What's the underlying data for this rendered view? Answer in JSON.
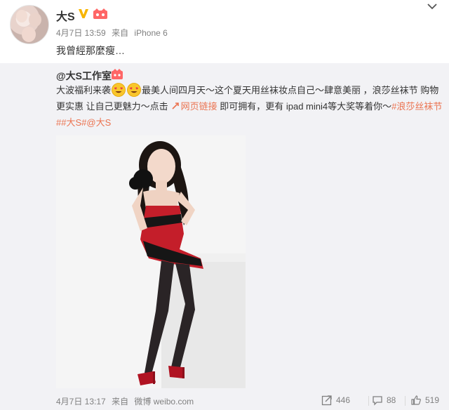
{
  "post": {
    "author": "大S",
    "date": "4月7日 13:59",
    "source_prefix": "来自",
    "source": "iPhone 6",
    "text": "我曾經那麼瘦…"
  },
  "repost": {
    "user": "@大S工作室",
    "text_1": "大波福利来袭",
    "text_2": "最美人间四月天～这个夏天用丝袜妆点自己～肆意美丽 ，浪莎丝袜节 购物更实惠 让自己更魅力～点击",
    "link_text": "网页链接",
    "text_3": " 即可拥有，更有 ipad mini4等大奖等着你～",
    "hashtag_1": "#浪莎丝袜节#",
    "hashtag_2": "#大S#",
    "mention": "@大S",
    "date": "4月7日 13:17",
    "source_prefix": "来自",
    "source": "微博 weibo.com",
    "reposts": "446",
    "comments": "88",
    "likes": "519"
  },
  "icons": {
    "verified": "verified-v-icon",
    "vip": "vip-badge-icon",
    "menu": "chevron-down-icon",
    "emoji": "heart-eyes-emoji-icon",
    "link": "link-icon",
    "repost": "repost-icon",
    "comment": "comment-icon",
    "like": "thumbs-up-icon"
  },
  "colors": {
    "link": "#eb7350",
    "meta": "#808080",
    "repost_bg": "#f2f2f5",
    "verified": "#f7b500"
  }
}
